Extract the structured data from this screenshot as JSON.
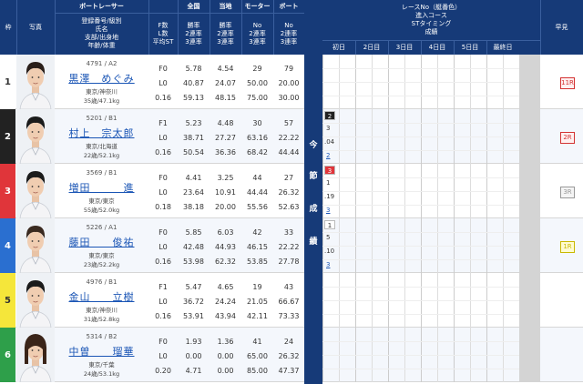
{
  "header": {
    "waku": "枠",
    "boat_racer": "ボートレーサー",
    "photo": "写真",
    "racer_info": [
      "登録番号/級別",
      "氏名",
      "支部/出身地",
      "年齢/体重"
    ],
    "f_l_st": [
      "F数",
      "L数",
      "平均ST"
    ],
    "zenkoku": "全国",
    "touchi": "当地",
    "motor": "モーター",
    "boat": "ボート",
    "rate_cols": [
      "勝率",
      "2連率",
      "3連率"
    ],
    "no_cols": [
      "No",
      "2連率",
      "3連率"
    ],
    "race_info": [
      "レースNo（艇番色）",
      "進入コース",
      "STタイミング",
      "成績"
    ],
    "days": [
      "初日",
      "2日目",
      "3日目",
      "4日目",
      "5日目",
      "最終日"
    ],
    "zenken": "早見"
  },
  "mid_label": [
    "今",
    "節",
    "成",
    "績"
  ],
  "racers": [
    {
      "waku": "1",
      "reg": "4791 / A2",
      "name": "黒澤　めぐみ",
      "branch": "東京/神奈川",
      "age": "35歳/47.1kg",
      "f": "F0",
      "l": "L0",
      "st": "0.16",
      "z1": "5.78",
      "z2": "40.87",
      "z3": "59.13",
      "t1": "4.54",
      "t2": "24.07",
      "t3": "48.15",
      "m1": "29",
      "m2": "50.00",
      "m3": "75.00",
      "b1": "79",
      "b2": "20.00",
      "b3": "30.00",
      "hayami": "11R"
    },
    {
      "waku": "2",
      "reg": "5201 / B1",
      "name": "村上　宗太郎",
      "branch": "東京/北海道",
      "age": "22歳/52.1kg",
      "f": "F1",
      "l": "L0",
      "st": "0.16",
      "z1": "5.23",
      "z2": "38.71",
      "z3": "50.54",
      "t1": "4.48",
      "t2": "27.27",
      "t3": "36.36",
      "m1": "30",
      "m2": "63.16",
      "m3": "68.42",
      "b1": "57",
      "b2": "22.22",
      "b3": "44.44",
      "hayami": "2R",
      "r1": {
        "no": "2",
        "course": "3",
        "st": ".04",
        "result": "2"
      }
    },
    {
      "waku": "3",
      "reg": "3569 / B1",
      "name": "増田　　　進",
      "branch": "東京/東京",
      "age": "55歳/52.0kg",
      "f": "F0",
      "l": "L0",
      "st": "0.18",
      "z1": "4.41",
      "z2": "23.64",
      "z3": "38.18",
      "t1": "3.25",
      "t2": "10.91",
      "t3": "20.00",
      "m1": "44",
      "m2": "44.44",
      "m3": "55.56",
      "b1": "27",
      "b2": "26.32",
      "b3": "52.63",
      "hayami": "3R",
      "r1": {
        "no": "3",
        "course": "1",
        "st": ".19",
        "result": "3"
      }
    },
    {
      "waku": "4",
      "reg": "5226 / A1",
      "name": "藤田　　俊祐",
      "branch": "東京/東京",
      "age": "23歳/52.2kg",
      "f": "F0",
      "l": "L0",
      "st": "0.16",
      "z1": "5.85",
      "z2": "42.48",
      "z3": "53.98",
      "t1": "6.03",
      "t2": "44.93",
      "t3": "62.32",
      "m1": "42",
      "m2": "46.15",
      "m3": "53.85",
      "b1": "33",
      "b2": "22.22",
      "b3": "27.78",
      "hayami": "1R",
      "r1": {
        "no": "1",
        "course": "5",
        "st": ".10",
        "result": "3"
      }
    },
    {
      "waku": "5",
      "reg": "4976 / B1",
      "name": "金山　　立樹",
      "branch": "東京/神奈川",
      "age": "31歳/52.8kg",
      "f": "F1",
      "l": "L0",
      "st": "0.16",
      "z1": "5.47",
      "z2": "36.72",
      "z3": "53.91",
      "t1": "4.65",
      "t2": "24.24",
      "t3": "43.94",
      "m1": "19",
      "m2": "21.05",
      "m3": "42.11",
      "b1": "43",
      "b2": "66.67",
      "b3": "73.33"
    },
    {
      "waku": "6",
      "reg": "5314 / B2",
      "name": "中曽　　瑠華",
      "branch": "東京/千葉",
      "age": "24歳/53.1kg",
      "f": "F0",
      "l": "L0",
      "st": "0.20",
      "z1": "1.93",
      "z2": "0.00",
      "z3": "4.71",
      "t1": "1.36",
      "t2": "0.00",
      "t3": "0.00",
      "m1": "41",
      "m2": "65.00",
      "m3": "85.00",
      "b1": "24",
      "b2": "26.32",
      "b3": "47.37"
    }
  ],
  "colors": {
    "header_bg": "#163a78",
    "waku": [
      "#ffffff",
      "#222222",
      "#e0353a",
      "#2a6fd0",
      "#f5e63a",
      "#2e9f4a"
    ],
    "waku_text": [
      "#333333",
      "#ffffff",
      "#ffffff",
      "#ffffff",
      "#333333",
      "#ffffff"
    ],
    "hayami_red": "#d33333",
    "hayami_gray": "#999999",
    "hayami_yellow": "#e5d200"
  }
}
